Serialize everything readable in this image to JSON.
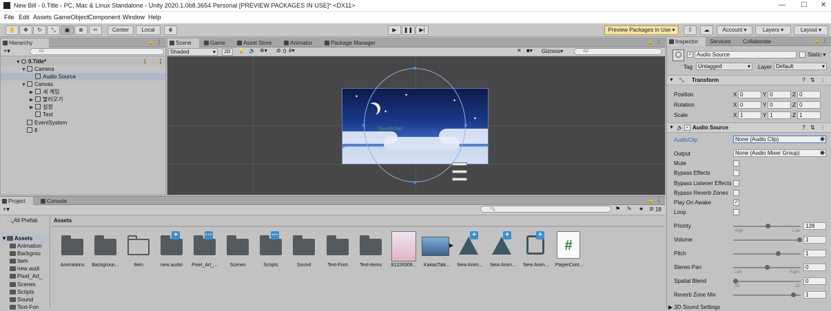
{
  "window": {
    "title": "New Bill - 0.Title - PC, Mac & Linux Standalone - Unity 2020.1.0b8.3654 Personal [PREVIEW PACKAGES IN USE]* <DX11>",
    "minimize": "—",
    "maximize": "☐",
    "close": "✕"
  },
  "menu": [
    "File",
    "Edit",
    "Assets",
    "GameObject",
    "Component",
    "Window",
    "Help"
  ],
  "toolbar": {
    "center_label": "Center",
    "local_label": "Local",
    "preview_packages": "Preview Packages in Use ▾",
    "account": "Account ▾",
    "layers": "Layers ▾",
    "layout": "Layout ▾"
  },
  "hierarchy": {
    "tab": "Hierarchy",
    "search_placeholder": "All",
    "scene_name": "0.Title*",
    "scene_badge": "1",
    "items": [
      {
        "label": "Camera",
        "depth": 1,
        "expanded": true
      },
      {
        "label": "Audio Source",
        "depth": 2,
        "selected": true
      },
      {
        "label": "Canvas",
        "depth": 1,
        "expanded": true
      },
      {
        "label": "새 게임",
        "depth": 2,
        "collapsed": true
      },
      {
        "label": "불러오기",
        "depth": 2,
        "collapsed": true
      },
      {
        "label": "설정",
        "depth": 2,
        "collapsed": true
      },
      {
        "label": "Text",
        "depth": 2
      },
      {
        "label": "EventSystem",
        "depth": 1
      },
      {
        "label": "8",
        "depth": 1
      }
    ]
  },
  "scene": {
    "tabs": [
      "Scene",
      "Game",
      "Asset Store",
      "Animator",
      "Package Manager"
    ],
    "shading": "Shaded",
    "mode2d": "2D",
    "fx_count": "0",
    "gizmos": "Gizmos",
    "search_placeholder": "All",
    "canvas_text": "TouchToStart"
  },
  "project": {
    "tabs": [
      "Project",
      "Console"
    ],
    "hidden_count": "18",
    "favorites_label": "All Prefab",
    "breadcrumb": "Assets",
    "tree": [
      "Assets",
      "Animation",
      "Backgrou",
      "Item",
      "new audi",
      "Pixel_Art_",
      "Scenes",
      "Scripts",
      "Sound",
      "Text-Fon"
    ],
    "assets": [
      {
        "label": "Animations",
        "kind": "folder"
      },
      {
        "label": "Backgroun...",
        "kind": "folder"
      },
      {
        "label": "Item",
        "kind": "folder-empty"
      },
      {
        "label": "new audio",
        "kind": "folder-plus"
      },
      {
        "label": "Pixel_Art_...",
        "kind": "folder-more"
      },
      {
        "label": "Scenes",
        "kind": "folder"
      },
      {
        "label": "Scripts",
        "kind": "folder-more"
      },
      {
        "label": "Sound",
        "kind": "folder"
      },
      {
        "label": "Text-Font",
        "kind": "folder"
      },
      {
        "label": "Text-items",
        "kind": "folder"
      },
      {
        "label": "81226308...",
        "kind": "image"
      },
      {
        "label": "KakaoTalk...",
        "kind": "image2"
      },
      {
        "label": "New Anim...",
        "kind": "anim"
      },
      {
        "label": "New Anim...",
        "kind": "anim"
      },
      {
        "label": "New Anim...",
        "kind": "controller"
      },
      {
        "label": "PlayerCont...",
        "kind": "script"
      }
    ]
  },
  "inspector": {
    "tabs": [
      "Inspector",
      "Services",
      "Collaborate"
    ],
    "object_name": "Audio Source",
    "static_label": "Static",
    "tag_label": "Tag",
    "tag_value": "Untagged",
    "layer_label": "Layer",
    "layer_value": "Default",
    "transform": {
      "title": "Transform",
      "position_label": "Position",
      "rotation_label": "Rotation",
      "scale_label": "Scale",
      "position": [
        "0",
        "0",
        "0"
      ],
      "rotation": [
        "0",
        "0",
        "0"
      ],
      "scale": [
        "1",
        "1",
        "1"
      ]
    },
    "audio": {
      "title": "Audio Source",
      "clip_label": "AudioClip",
      "clip_value": "None (Audio Clip)",
      "output_label": "Output",
      "output_value": "None (Audio Mixer Group)",
      "mute": "Mute",
      "bypass_effects": "Bypass Effects",
      "bypass_listener": "Bypass Listener Effects",
      "bypass_reverb": "Bypass Reverb Zones",
      "play_on_awake": "Play On Awake",
      "loop": "Loop",
      "priority_label": "Priority",
      "priority_value": "128",
      "priority_high": "High",
      "priority_low": "Low",
      "volume_label": "Volume",
      "volume_value": "1",
      "pitch_label": "Pitch",
      "pitch_value": "1",
      "stereo_label": "Stereo Pan",
      "stereo_value": "0",
      "stereo_left": "Left",
      "stereo_right": "Right",
      "spatial_label": "Spatial Blend",
      "spatial_value": "0",
      "spatial_2d": "2D",
      "spatial_3d": "3D",
      "reverb_label": "Reverb Zone Mix",
      "reverb_value": "1",
      "sound3d": "3D Sound Settings"
    }
  },
  "xyz": [
    "X",
    "Y",
    "Z"
  ]
}
